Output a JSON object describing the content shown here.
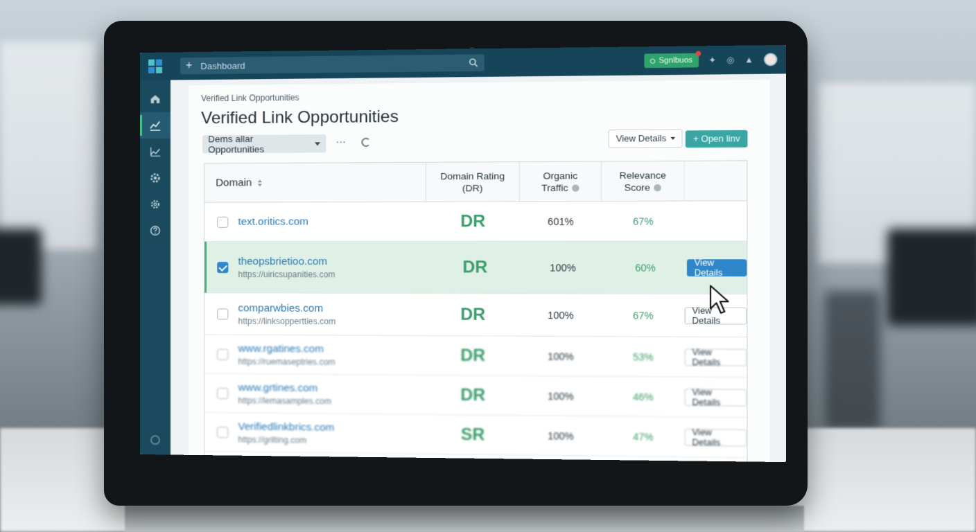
{
  "topbar": {
    "search_placeholder": "Dashboard",
    "status_label": "Sgnlbuos"
  },
  "sidebar": {
    "items": [
      {
        "icon": "home-icon"
      },
      {
        "icon": "line-chart-icon",
        "active": true
      },
      {
        "icon": "area-chart-icon"
      },
      {
        "icon": "gear-icon"
      },
      {
        "icon": "integrations-gear-icon"
      },
      {
        "icon": "help-icon"
      }
    ]
  },
  "page": {
    "breadcrumb": "Verified Link Opportunities",
    "title": "Verified Link Opportunities",
    "filter_value": "Dems allar Opportunities",
    "more_label": "···",
    "view_details_label": "View Details",
    "open_link_label": "+ Open linv"
  },
  "table": {
    "headers": {
      "domain": "Domain",
      "domain_rating": "Domain Rating (DR)",
      "organic_traffic": "Organic Traffic",
      "relevance_score": "Relevance Score"
    },
    "rows": [
      {
        "domain": "text.oritics.com",
        "url": "",
        "dr": "DR",
        "traffic": "601%",
        "score": "67%",
        "action": "",
        "checked": false
      },
      {
        "domain": "theopsbrietioo.com",
        "url": "https://uiricsupanities.com",
        "dr": "DR",
        "traffic": "100%",
        "score": "60%",
        "action": "View Details",
        "checked": true
      },
      {
        "domain": "comparwbies.com",
        "url": "https://linksoppertties.com",
        "dr": "DR",
        "traffic": "100%",
        "score": "67%",
        "action": "View Details",
        "checked": false
      },
      {
        "domain": "www.rgatines.com",
        "url": "https://ruemaseptries.com",
        "dr": "DR",
        "traffic": "100%",
        "score": "53%",
        "action": "View Details",
        "checked": false
      },
      {
        "domain": "www.grtines.com",
        "url": "https://lemasamples.com",
        "dr": "DR",
        "traffic": "100%",
        "score": "46%",
        "action": "View Details",
        "checked": false
      },
      {
        "domain": "Verifiedlinkbrics.com",
        "url": "https://grilting.com",
        "dr": "SR",
        "traffic": "100%",
        "score": "47%",
        "action": "View Details",
        "checked": false
      }
    ]
  },
  "colors": {
    "topbar": "#16455a",
    "sidebar": "#1b4a5e",
    "accent_green": "#3d9d6d",
    "accent_blue": "#2f86c9",
    "teal_button": "#3aa6a4"
  }
}
